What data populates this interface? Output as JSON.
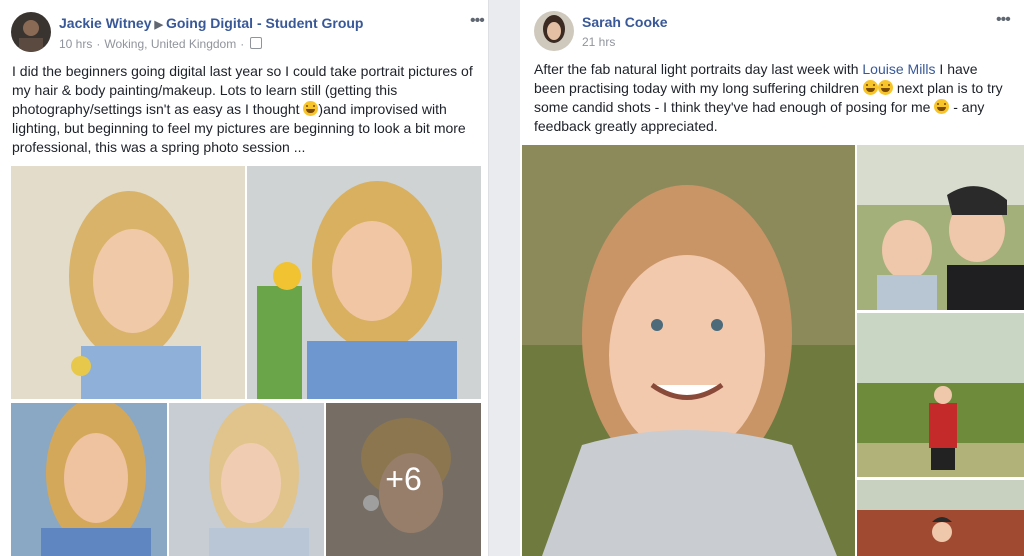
{
  "post1": {
    "author": "Jackie Witney",
    "group": "Going Digital - Student Group",
    "time": "10 hrs",
    "location": "Woking, United Kingdom",
    "text_a": "I did the beginners going digital last year so I could take portrait pictures of my hair & body painting/makeup. Lots to learn still (getting this photography/settings isn't as easy as I thought ",
    "text_b": ")and improvised with lighting, but beginning to feel my pictures are beginning to look a bit more professional, this was a spring photo session ...",
    "more_photos": "+6",
    "menu_icon": "ellipsis-icon"
  },
  "post2": {
    "author": "Sarah Cooke",
    "time": "21 hrs",
    "text_a": "After the fab natural light portraits day last week with ",
    "mention": "Louise Mills",
    "text_b": " I have been practising today with my long suffering children ",
    "text_c": " next plan is to try some candid shots - I think they've had enough of posing for me ",
    "text_d": " - any feedback greatly appreciated.",
    "menu_icon": "ellipsis-icon"
  },
  "colors": {
    "link": "#385898",
    "meta": "#90949c",
    "background": "#e9ebee"
  }
}
